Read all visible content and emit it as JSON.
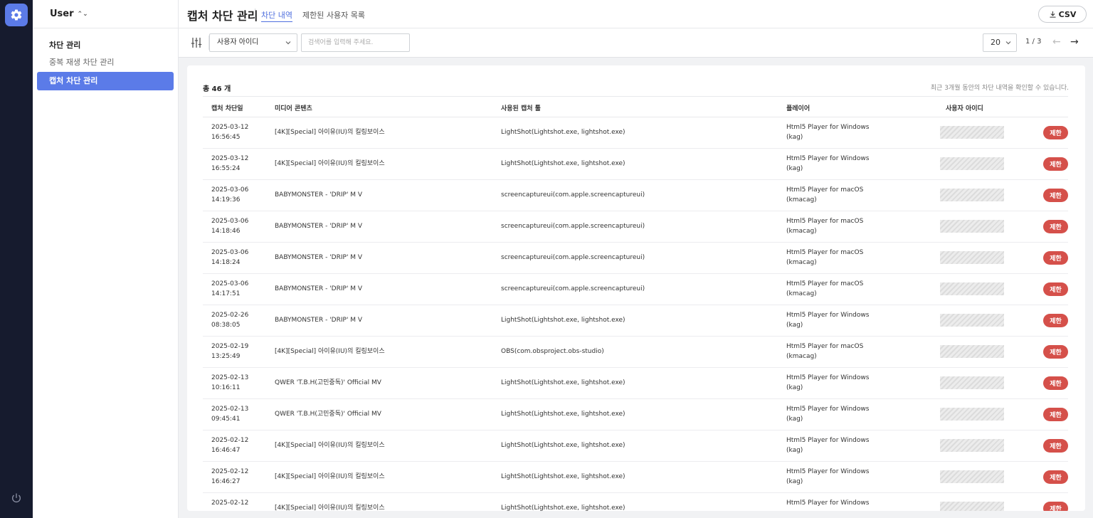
{
  "sidebar": {
    "app_switcher": "User",
    "section_title": "차단 관리",
    "items": [
      {
        "label": "중복 재생 차단 관리",
        "active": false
      },
      {
        "label": "캡처 차단 관리",
        "active": true
      }
    ]
  },
  "header": {
    "title": "캡처 차단 관리",
    "tabs": [
      {
        "label": "차단 내역",
        "active": true
      },
      {
        "label": "제한된 사용자 목록",
        "active": false
      }
    ],
    "csv_label": "CSV"
  },
  "filters": {
    "field_select": "사용자 아이디",
    "search_placeholder": "검색어를 입력해 주세요.",
    "page_size": "20",
    "page_info": "1 / 3"
  },
  "summary": {
    "total": "총 46 개",
    "notice": "최근 3개월 동안의 차단 내역을 확인할 수 있습니다."
  },
  "table": {
    "columns": [
      "캡처 차단일",
      "미디어 콘텐츠",
      "사용된 캡처 툴",
      "플레이어",
      "사용자 아이디"
    ],
    "action_label": "제한",
    "rows": [
      {
        "date": "2025-03-12",
        "time": "16:56:45",
        "media": "[4K][Special] 아이유(IU)의 킬링보이스",
        "tool": "LightShot(Lightshot.exe, lightshot.exe)",
        "player": "Html5 Player for Windows",
        "player_id": "(kag)"
      },
      {
        "date": "2025-03-12",
        "time": "16:55:24",
        "media": "[4K][Special] 아이유(IU)의 킬링보이스",
        "tool": "LightShot(Lightshot.exe, lightshot.exe)",
        "player": "Html5 Player for Windows",
        "player_id": "(kag)"
      },
      {
        "date": "2025-03-06",
        "time": "14:19:36",
        "media": "BABYMONSTER - 'DRIP' M V",
        "tool": "screencaptureui(com.apple.screencaptureui)",
        "player": "Html5 Player for macOS",
        "player_id": "(kmacag)"
      },
      {
        "date": "2025-03-06",
        "time": "14:18:46",
        "media": "BABYMONSTER - 'DRIP' M V",
        "tool": "screencaptureui(com.apple.screencaptureui)",
        "player": "Html5 Player for macOS",
        "player_id": "(kmacag)"
      },
      {
        "date": "2025-03-06",
        "time": "14:18:24",
        "media": "BABYMONSTER - 'DRIP' M V",
        "tool": "screencaptureui(com.apple.screencaptureui)",
        "player": "Html5 Player for macOS",
        "player_id": "(kmacag)"
      },
      {
        "date": "2025-03-06",
        "time": "14:17:51",
        "media": "BABYMONSTER - 'DRIP' M V",
        "tool": "screencaptureui(com.apple.screencaptureui)",
        "player": "Html5 Player for macOS",
        "player_id": "(kmacag)"
      },
      {
        "date": "2025-02-26",
        "time": "08:38:05",
        "media": "BABYMONSTER - 'DRIP' M V",
        "tool": "LightShot(Lightshot.exe, lightshot.exe)",
        "player": "Html5 Player for Windows",
        "player_id": "(kag)"
      },
      {
        "date": "2025-02-19",
        "time": "13:25:49",
        "media": "[4K][Special] 아이유(IU)의 킬링보이스",
        "tool": "OBS(com.obsproject.obs-studio)",
        "player": "Html5 Player for macOS",
        "player_id": "(kmacag)"
      },
      {
        "date": "2025-02-13",
        "time": "10:16:11",
        "media": "QWER 'T.B.H(고민중독)' Official MV",
        "tool": "LightShot(Lightshot.exe, lightshot.exe)",
        "player": "Html5 Player for Windows",
        "player_id": "(kag)"
      },
      {
        "date": "2025-02-13",
        "time": "09:45:41",
        "media": "QWER 'T.B.H(고민중독)' Official MV",
        "tool": "LightShot(Lightshot.exe, lightshot.exe)",
        "player": "Html5 Player for Windows",
        "player_id": "(kag)"
      },
      {
        "date": "2025-02-12",
        "time": "16:46:47",
        "media": "[4K][Special] 아이유(IU)의 킬링보이스",
        "tool": "LightShot(Lightshot.exe, lightshot.exe)",
        "player": "Html5 Player for Windows",
        "player_id": "(kag)"
      },
      {
        "date": "2025-02-12",
        "time": "16:46:27",
        "media": "[4K][Special] 아이유(IU)의 킬링보이스",
        "tool": "LightShot(Lightshot.exe, lightshot.exe)",
        "player": "Html5 Player for Windows",
        "player_id": "(kag)"
      },
      {
        "date": "2025-02-12",
        "time": "",
        "media": "[4K][Special] 아이유(IU)의 킬링보이스",
        "tool": "LightShot(Lightshot.exe, lightshot.exe)",
        "player": "Html5 Player for Windows",
        "player_id": ""
      }
    ]
  },
  "colors": {
    "accent": "#5b7be8",
    "rail": "#161b2e",
    "danger": "#d5504a"
  },
  "icons": {
    "logo": "gear-icon",
    "power": "power-icon",
    "csv": "download-icon",
    "filter": "sliders-icon",
    "prev": "arrow-left-icon",
    "next": "arrow-right-icon"
  }
}
